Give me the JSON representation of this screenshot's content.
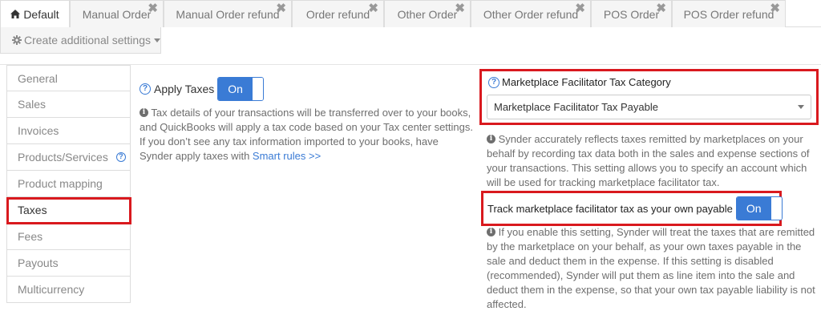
{
  "tabs": [
    {
      "label": "Default",
      "active": true
    },
    {
      "label": "Manual Order",
      "closable": true
    },
    {
      "label": "Manual Order refund",
      "closable": true
    },
    {
      "label": "Order refund",
      "closable": true
    },
    {
      "label": "Other Order",
      "closable": true
    },
    {
      "label": "Other Order refund",
      "closable": true
    },
    {
      "label": "POS Order",
      "closable": true
    },
    {
      "label": "POS Order refund",
      "closable": true
    }
  ],
  "close_glyph": "✖",
  "create_settings_label": "Create additional settings",
  "sidebar": {
    "items": [
      {
        "label": "General"
      },
      {
        "label": "Sales"
      },
      {
        "label": "Invoices"
      },
      {
        "label": "Products/Services",
        "help": "?"
      },
      {
        "label": "Product mapping"
      },
      {
        "label": "Taxes",
        "active": true
      },
      {
        "label": "Fees"
      },
      {
        "label": "Payouts"
      },
      {
        "label": "Multicurrency"
      }
    ]
  },
  "apply_taxes": {
    "help": "?",
    "label": "Apply Taxes",
    "toggle": "On",
    "info_lines": [
      "Tax details of your transactions will be transferred over to your books,",
      "and QuickBooks will apply a tax code based on your Tax center settings.",
      "If you don’t see any tax information imported to your books, have",
      "Synder apply taxes with "
    ],
    "link": "Smart rules >>"
  },
  "mft": {
    "help": "?",
    "label": "Marketplace Facilitator Tax Category",
    "selected": "Marketplace Facilitator Tax Payable",
    "info_lines": [
      "Synder accurately reflects taxes remitted by marketplaces on your",
      "behalf by recording tax data both in the sales and expense sections of",
      "your transactions. This setting allows you to specify an account which",
      "will be used for tracking marketplace facilitator tax."
    ]
  },
  "track": {
    "label": "Track marketplace facilitator tax as your own payable",
    "toggle": "On",
    "info_lines": [
      "If you enable this setting, Synder will treat the taxes that are remitted",
      "by the marketplace on your behalf, as your own taxes payable in the",
      "sale and deduct them in the expense. If this setting is disabled",
      "(recommended), Synder will put them as line item into the sale and",
      "deduct them in the expense, so that your own tax payable liability is not",
      "affected."
    ]
  },
  "info_glyph": "i",
  "highlight_color": "#d9191e",
  "accent_color": "#3a7bd5"
}
